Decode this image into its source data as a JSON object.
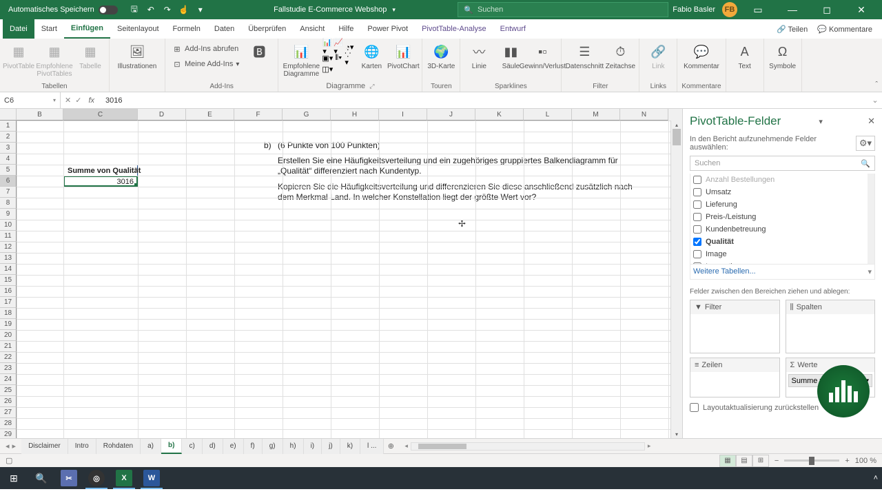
{
  "titlebar": {
    "autosave": "Automatisches Speichern",
    "docTitle": "Fallstudie E-Commerce Webshop",
    "searchPlaceholder": "Suchen",
    "user": "Fabio Basler",
    "userInitials": "FB"
  },
  "tabs": {
    "datei": "Datei",
    "start": "Start",
    "einfuegen": "Einfügen",
    "seitenlayout": "Seitenlayout",
    "formeln": "Formeln",
    "daten": "Daten",
    "ueberpruefen": "Überprüfen",
    "ansicht": "Ansicht",
    "hilfe": "Hilfe",
    "powerpivot": "Power Pivot",
    "ptanalyse": "PivotTable-Analyse",
    "entwurf": "Entwurf",
    "teilen": "Teilen",
    "kommentare": "Kommentare"
  },
  "ribbon": {
    "pivottable": "PivotTable",
    "empfohlene": "Empfohlene PivotTables",
    "tabelle": "Tabelle",
    "tabellen": "Tabellen",
    "illustrationen": "Illustrationen",
    "addinsAbrufen": "Add-Ins abrufen",
    "meineAddins": "Meine Add-Ins",
    "addins": "Add-Ins",
    "empfohleneDiagramme": "Empfohlene Diagramme",
    "karten": "Karten",
    "pivotchart": "PivotChart",
    "diagramme": "Diagramme",
    "karte3d": "3D-Karte",
    "touren": "Touren",
    "linie": "Linie",
    "saeule": "Säule",
    "gewinnVerlust": "Gewinn/Verlust",
    "sparklines": "Sparklines",
    "datenschnitt": "Datenschnitt",
    "zeitachse": "Zeitachse",
    "filter": "Filter",
    "link": "Link",
    "links": "Links",
    "kommentar": "Kommentar",
    "kommentare": "Kommentare",
    "text": "Text",
    "symbole": "Symbole"
  },
  "namebox": "C6",
  "formulaValue": "3016",
  "columns": [
    "B",
    "C",
    "D",
    "E",
    "F",
    "G",
    "H",
    "I",
    "J",
    "K",
    "L",
    "M",
    "N"
  ],
  "cells": {
    "b1": "b)",
    "q1": "(6 Punkte von 100 Punkten)",
    "t1": "Erstellen Sie eine Häufigkeitsverteilung und ein zugehöriges gruppiertes Balkendiagramm für „Qualität“ differenziert nach Kundentyp.",
    "t2": "Kopieren Sie die Häufigkeitsverteilung und differenzieren Sie diese anschließend zusätzlich nach dem Merkmal Land. In welcher Konstellation liegt der größte Wert vor?",
    "c5": "Summe von Qualität",
    "c6": "3016"
  },
  "pane": {
    "title": "PivotTable-Felder",
    "sub": "In den Bericht aufzunehmende Felder auswählen:",
    "searchPlaceholder": "Suchen",
    "fields": [
      {
        "label": "Anzahl Bestellungen",
        "checked": false,
        "cut": true
      },
      {
        "label": "Umsatz",
        "checked": false
      },
      {
        "label": "Lieferung",
        "checked": false
      },
      {
        "label": "Preis-/Leistung",
        "checked": false
      },
      {
        "label": "Kundenbetreuung",
        "checked": false
      },
      {
        "label": "Qualität",
        "checked": true
      },
      {
        "label": "Image",
        "checked": false
      },
      {
        "label": "Innovation",
        "checked": false
      }
    ],
    "weitere": "Weitere Tabellen...",
    "areasLabel": "Felder zwischen den Bereichen ziehen und ablegen:",
    "filter": "Filter",
    "spalten": "Spalten",
    "zeilen": "Zeilen",
    "werte": "Werte",
    "werteValue": "Summe von Qualität",
    "defer": "Layoutaktualisierung zurückstellen"
  },
  "sheetTabs": [
    "Disclaimer",
    "Intro",
    "Rohdaten",
    "a)",
    "b)",
    "c)",
    "d)",
    "e)",
    "f)",
    "g)",
    "h)",
    "i)",
    "j)",
    "k)",
    "l ..."
  ],
  "activeSheet": "b)",
  "status": {
    "zoom": "100 %"
  }
}
